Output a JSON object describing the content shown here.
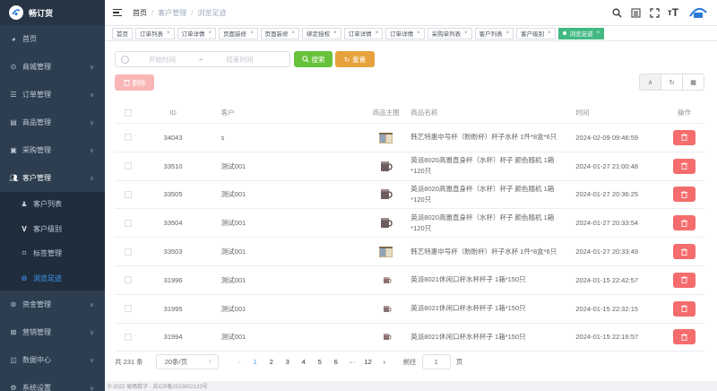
{
  "brand": {
    "name": "畅订货"
  },
  "sidebar": {
    "items": [
      {
        "label": "首页",
        "icon": "dashboard-icon"
      },
      {
        "label": "商城管理",
        "icon": "shop-icon"
      },
      {
        "label": "订单管理",
        "icon": "list-icon"
      },
      {
        "label": "商品管理",
        "icon": "goods-icon"
      },
      {
        "label": "采购管理",
        "icon": "purchase-icon"
      },
      {
        "label": "客户管理",
        "icon": "user-group-icon"
      }
    ],
    "sub_items": [
      {
        "label": "客户列表",
        "icon": "user-group-icon"
      },
      {
        "label": "客户级别",
        "icon": "v-letter-icon"
      },
      {
        "label": "标签管理",
        "icon": "bookmark-icon"
      },
      {
        "label": "浏览足迹",
        "icon": "footprint-icon"
      }
    ],
    "items_after": [
      {
        "label": "资金管理",
        "icon": "fund-icon"
      },
      {
        "label": "营销管理",
        "icon": "marketing-icon"
      },
      {
        "label": "数据中心",
        "icon": "data-icon"
      },
      {
        "label": "系统设置",
        "icon": "settings-icon"
      }
    ]
  },
  "breadcrumb": [
    "首页",
    "客户管理",
    "浏览足迹"
  ],
  "tabs": [
    "首页",
    "订单列表",
    "订单详情",
    "页面装修",
    "页面装修",
    "绑定授权",
    "订单详情",
    "订单详情",
    "采购单列表",
    "客户列表",
    "客户级别",
    "浏览足迹"
  ],
  "filters": {
    "start_placeholder": "开始时间",
    "range_sep": "~",
    "end_placeholder": "结束时间",
    "search_label": "搜索",
    "reset_label": "重置",
    "delete_label": "删除"
  },
  "table": {
    "headers": {
      "id": "ID",
      "customer": "客户",
      "image": "商品主图",
      "name": "商品名称",
      "time": "时间",
      "op": "操作"
    },
    "rows": [
      {
        "id": "34043",
        "customer": "s",
        "image": "box",
        "name": "韩艺特惠中号杯（盼盼杯）杯子水杯 1件*8盒*6只",
        "time": "2024-02-09 09:46:59"
      },
      {
        "id": "33510",
        "customer": "测试001",
        "image": "mug",
        "name": "英派8020高雅直身杯（水杯）杯子 颜色随机 1箱*120只",
        "time": "2024-01-27 21:00:48"
      },
      {
        "id": "33505",
        "customer": "测试001",
        "image": "mug",
        "name": "英派8020高雅直身杯（水杯）杯子 颜色随机 1箱*120只",
        "time": "2024-01-27 20:36:25"
      },
      {
        "id": "33504",
        "customer": "测试001",
        "image": "mug",
        "name": "英派8020高雅直身杯（水杯）杯子 颜色随机 1箱*120只",
        "time": "2024-01-27 20:33:54"
      },
      {
        "id": "33503",
        "customer": "测试001",
        "image": "box",
        "name": "韩艺特惠中号杯（盼盼杯）杯子水杯 1件*8盒*6只",
        "time": "2024-01-27 20:33:49"
      },
      {
        "id": "31996",
        "customer": "测试001",
        "image": "cup",
        "name": "英派8021休闲口杯水杯杯子 1箱*150只",
        "time": "2024-01-15 22:42:57"
      },
      {
        "id": "31995",
        "customer": "测试001",
        "image": "cup",
        "name": "英派8021休闲口杯水杯杯子 1箱*150只",
        "time": "2024-01-15 22:32:15"
      },
      {
        "id": "31994",
        "customer": "测试001",
        "image": "cup",
        "name": "英派8021休闲口杯水杯杯子 1箱*150只",
        "time": "2024-01-15 22:16:57"
      }
    ]
  },
  "pagination": {
    "total": "共 231 条",
    "page_size": "20条/页",
    "pages": [
      "1",
      "2",
      "3",
      "4",
      "5",
      "6",
      "···",
      "12"
    ],
    "current": "1",
    "goto_label": "前往",
    "goto_value": "1",
    "page_unit": "页"
  },
  "footer": "© 2022 易畅数字 · 苏ICP备2023002133号",
  "colors": {
    "sidebar": "#2c3e50",
    "active_tab": "#42b983",
    "search": "#67c23a",
    "reset": "#e6a23c",
    "danger": "#f56c6c",
    "link": "#409eff"
  }
}
